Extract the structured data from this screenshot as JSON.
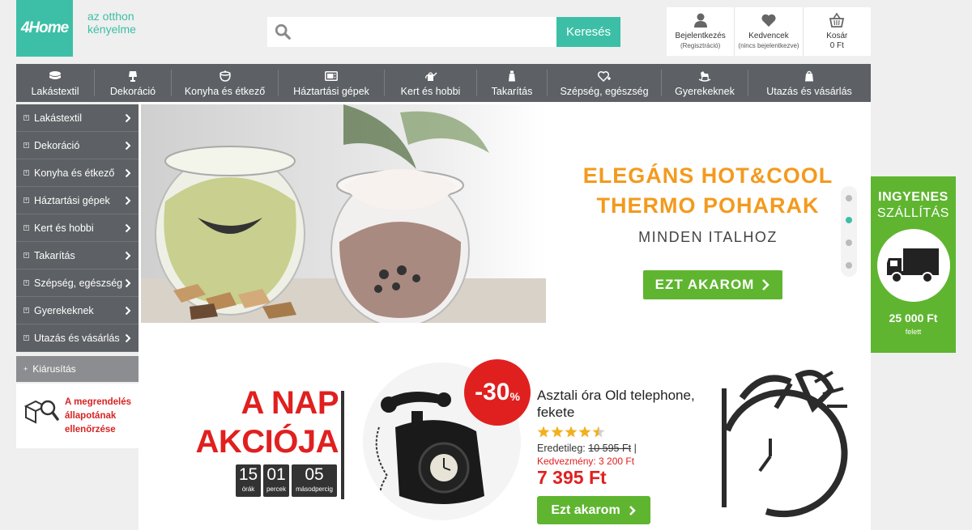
{
  "header": {
    "logo_text": "4Home",
    "tagline_line1": "az otthon",
    "tagline_line2": "kényelme",
    "search_placeholder": "",
    "search_button": "Keresés"
  },
  "account": {
    "login_label": "Bejelentkezés",
    "login_sub": "(Regisztráció)",
    "favorites_label": "Kedvencek",
    "favorites_sub": "(nincs bejelentkezve)",
    "cart_label": "Kosár",
    "cart_total": "0 Ft"
  },
  "nav": [
    {
      "label": "Lakástextil",
      "icon": "textile-icon"
    },
    {
      "label": "Dekoráció",
      "icon": "lamp-icon"
    },
    {
      "label": "Konyha és étkező",
      "icon": "pot-icon"
    },
    {
      "label": "Háztartási gépek",
      "icon": "microwave-icon"
    },
    {
      "label": "Kert és hobbi",
      "icon": "watering-can-icon"
    },
    {
      "label": "Takarítás",
      "icon": "spray-bottle-icon"
    },
    {
      "label": "Szépség, egészség",
      "icon": "heart-plus-icon"
    },
    {
      "label": "Gyerekeknek",
      "icon": "rocking-horse-icon"
    },
    {
      "label": "Utazás és vásárlás",
      "icon": "bag-icon"
    }
  ],
  "sidebar": {
    "items": [
      {
        "label": "Lakástextil"
      },
      {
        "label": "Dekoráció"
      },
      {
        "label": "Konyha és étkező"
      },
      {
        "label": "Háztartási gépek"
      },
      {
        "label": "Kert és hobbi"
      },
      {
        "label": "Takarítás"
      },
      {
        "label": "Szépség, egészség"
      },
      {
        "label": "Gyerekeknek"
      },
      {
        "label": "Utazás és vásárlás"
      }
    ],
    "sale_label": "Kiárusítás",
    "order_check_line1": "A megrendelés",
    "order_check_line2": "állapotának",
    "order_check_line3": "ellenőrzése"
  },
  "banner": {
    "headline_line1": "ELEGÁNS HOT&COOL",
    "headline_line2": "THERMO POHARAK",
    "subline": "MINDEN ITALHOZ",
    "cta": "EZT AKAROM",
    "slide_count": 4,
    "active_slide": 2
  },
  "shipping": {
    "line1": "INGYENES",
    "line2": "SZÁLLÍTÁS",
    "threshold": "25 000 Ft",
    "threshold_note": "felett"
  },
  "deal": {
    "title_line1": "A NAP",
    "title_line2": "AKCIÓJA",
    "timer": [
      {
        "value": "15",
        "unit": "órák"
      },
      {
        "value": "01",
        "unit": "percek"
      },
      {
        "value": "05",
        "unit": "másodpercig"
      }
    ],
    "discount": "-30",
    "discount_unit": "%",
    "product_name": "Asztali óra Old telephone, fekete",
    "rating": 4.5,
    "original_label": "Eredetileg:",
    "original_price": "10 595 Ft",
    "original_sep": "|",
    "saving_label": "Kedvezmény: 3 200 Ft",
    "price": "7 395 Ft",
    "buy_button": "Ezt akarom"
  },
  "colors": {
    "brand": "#3cbfa6",
    "nav_bg": "#5d6064",
    "green": "#5fb530",
    "red": "#e0201f",
    "orange": "#f39a1d"
  }
}
